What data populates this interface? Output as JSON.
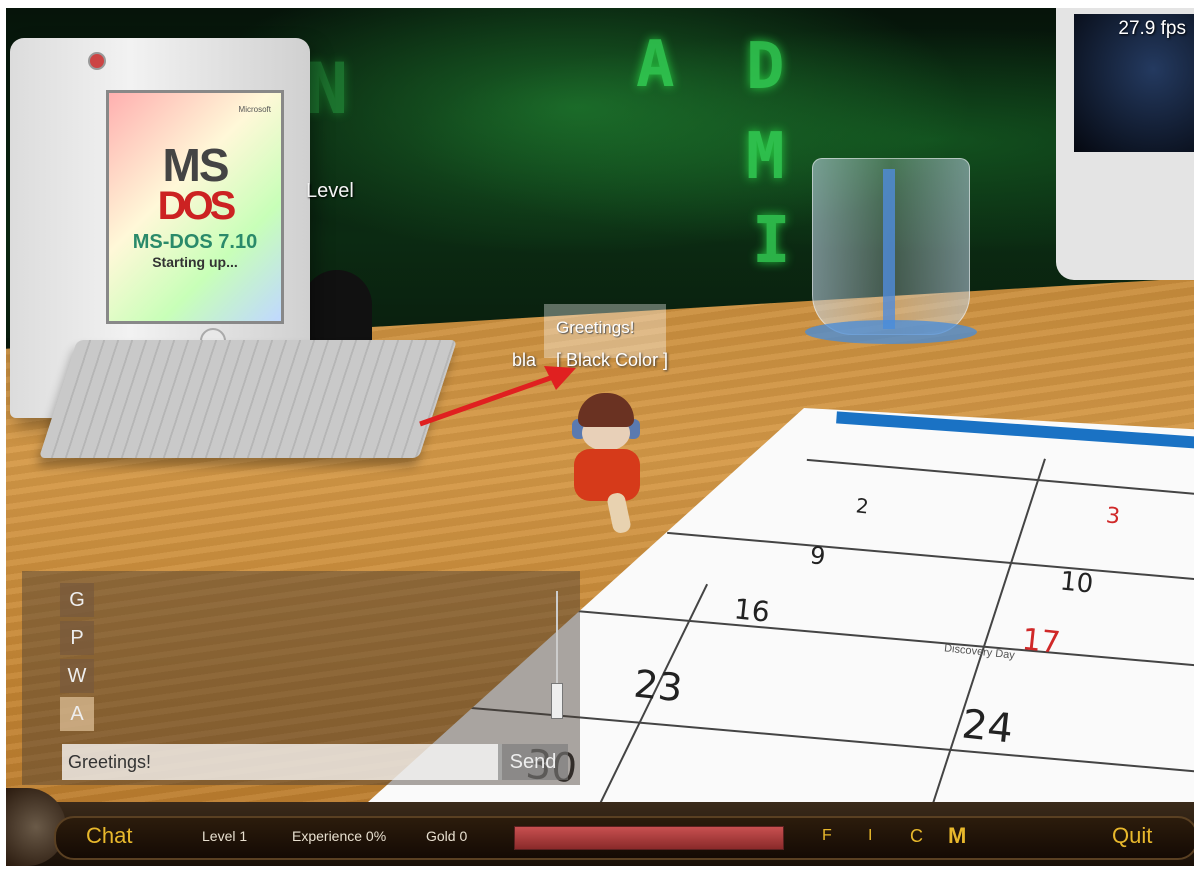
{
  "hud": {
    "fps": "27.9 fps"
  },
  "scene": {
    "floating_label": "Level",
    "monitor_screen": {
      "brand": "Microsoft",
      "logo_top": "MS",
      "logo_bottom": "DOS",
      "version": "MS-DOS 7.10",
      "status": "Starting up..."
    },
    "wall_glyphs": [
      "A",
      "D",
      "M",
      "I",
      "N"
    ],
    "calendar": {
      "days": [
        "2",
        "3",
        "9",
        "10",
        "16",
        "17",
        "23",
        "24",
        "30"
      ],
      "event": "Discovery Day"
    }
  },
  "player": {
    "speech_bubble": "Greetings!",
    "name_tag": "bla    [ Black Color ]"
  },
  "chat": {
    "channels": [
      {
        "label": "G",
        "active": false
      },
      {
        "label": "P",
        "active": false
      },
      {
        "label": "W",
        "active": false
      },
      {
        "label": "A",
        "active": true
      }
    ],
    "input_value": "Greetings!",
    "send_label": "Send"
  },
  "bottom_bar": {
    "chat_label": "Chat",
    "level": "Level 1",
    "experience": "Experience 0%",
    "gold": "Gold 0",
    "experience_progress": 0,
    "menu_buttons": [
      "F",
      "I",
      "C",
      "M"
    ],
    "quit_label": "Quit"
  },
  "colors": {
    "accent": "#e8b82c",
    "xp_bar": "#c85050",
    "arrow": "#e02020"
  }
}
